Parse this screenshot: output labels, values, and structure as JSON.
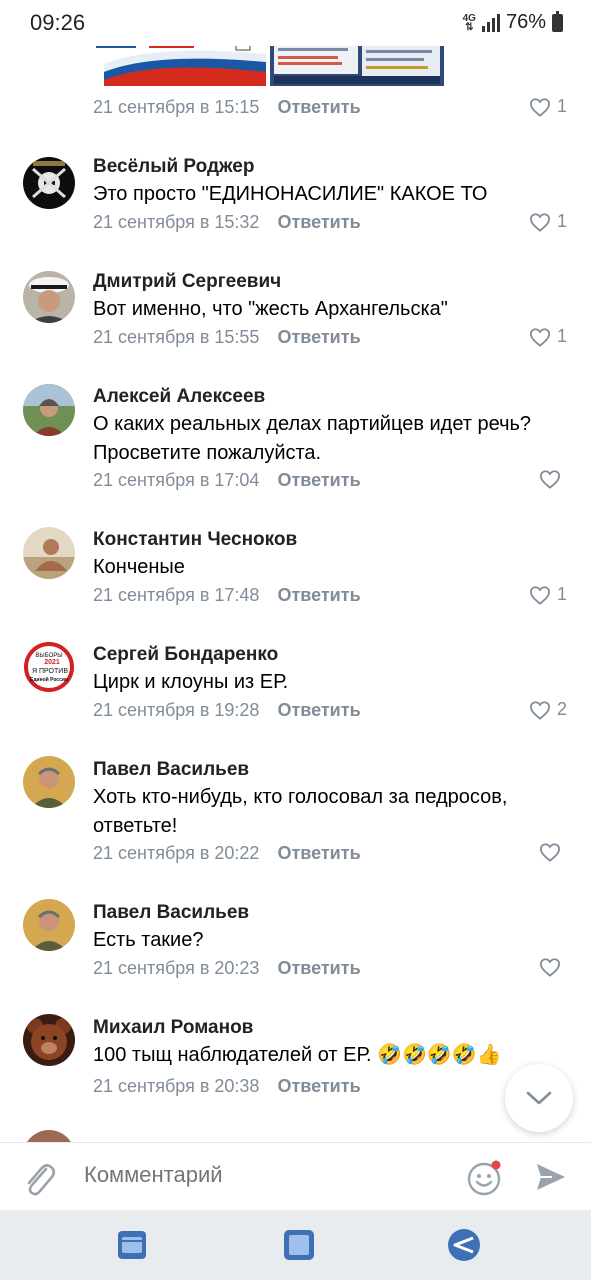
{
  "status_bar": {
    "time": "09:26",
    "network": "4G",
    "battery": "76%"
  },
  "top_comment": {
    "date": "21 сентября в 15:15",
    "reply_label": "Ответить",
    "likes": "1"
  },
  "comments": [
    {
      "author": "Весёлый Роджер",
      "text": "Это просто \"ЕДИНОНАСИЛИЕ\" КАКОЕ ТО",
      "date": "21 сентября в 15:32",
      "reply_label": "Ответить",
      "likes": "1"
    },
    {
      "author": "Дмитрий Сергеевич",
      "text": "Вот именно, что \"жесть Архангельска\"",
      "date": "21 сентября в 15:55",
      "reply_label": "Ответить",
      "likes": "1"
    },
    {
      "author": "Алексей Алексеев",
      "text": "О каких реальных делах партийцев идет речь? Просветите пожалуйста.",
      "date": "21 сентября в 17:04",
      "reply_label": "Ответить",
      "likes": ""
    },
    {
      "author": "Константин Чесноков",
      "text": "Конченые",
      "date": "21 сентября в 17:48",
      "reply_label": "Ответить",
      "likes": "1"
    },
    {
      "author": "Сергей Бондаренко",
      "text": "Цирк и клоуны из ЕР.",
      "date": "21 сентября в 19:28",
      "reply_label": "Ответить",
      "likes": "2"
    },
    {
      "author": "Павел Васильев",
      "text": "Хоть кто-нибудь, кто голосовал за педросов, ответьте!",
      "date": "21 сентября в 20:22",
      "reply_label": "Ответить",
      "likes": ""
    },
    {
      "author": "Павел Васильев",
      "text": "Есть такие?",
      "date": "21 сентября в 20:23",
      "reply_label": "Ответить",
      "likes": ""
    },
    {
      "author": "Михаил Романов",
      "text": "100 тыщ наблюдателей от ЕР. 🤣🤣🤣🤣👍",
      "date": "21 сентября в 20:38",
      "reply_label": "Ответить",
      "likes": ""
    }
  ],
  "avatar_badge": {
    "line1": "ВЫБОРЫ",
    "line2": "2021",
    "line3": "Я ПРОТИВ",
    "line4": "Единой России"
  },
  "composer": {
    "placeholder": "Комментарий"
  },
  "colors": {
    "meta": "#818c99",
    "accent": "#2a5885",
    "notification_dot": "#e64646"
  }
}
